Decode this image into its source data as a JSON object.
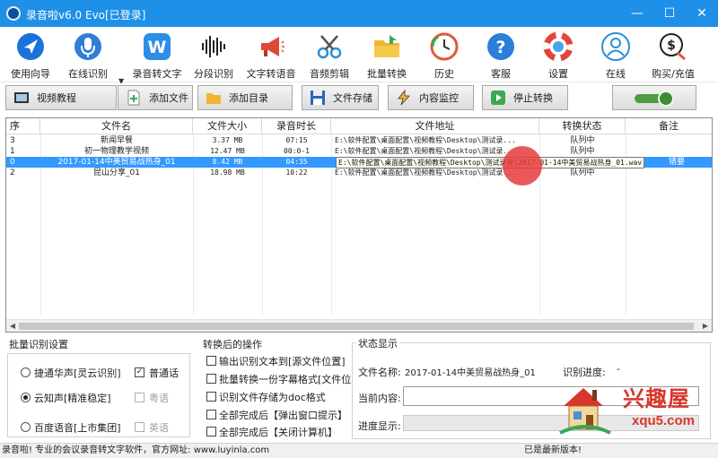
{
  "window": {
    "title": "录音啦v6.0 Evo[已登录]",
    "controls": [
      "—",
      "☐",
      "✕"
    ]
  },
  "toolbar": {
    "items": [
      {
        "label": "使用向导",
        "icon": "navigation-arrow-icon"
      },
      {
        "label": "在线识别",
        "icon": "microphone-icon"
      },
      {
        "label": "录音转文字",
        "icon": "w-letter-icon"
      },
      {
        "label": "分段识别",
        "icon": "soundwave-icon"
      },
      {
        "label": "文字转语音",
        "icon": "megaphone-icon"
      },
      {
        "label": "音频剪辑",
        "icon": "scissors-icon"
      },
      {
        "label": "批量转换",
        "icon": "folder-icon"
      },
      {
        "label": "历史",
        "icon": "history-clock-icon"
      },
      {
        "label": "客服",
        "icon": "help-question-icon"
      },
      {
        "label": "设置",
        "icon": "lifebuoy-icon"
      },
      {
        "label": "在线",
        "icon": "user-icon"
      },
      {
        "label": "购买/充值",
        "icon": "dollar-icon"
      }
    ],
    "dropdown": "▼"
  },
  "actions": {
    "video_tutorial": "视频教程",
    "add_file": "添加文件",
    "add_folder": "添加目录",
    "save_file": "文件存储",
    "content_monitor": "内容监控",
    "stop_convert": "停止转换"
  },
  "table": {
    "headers": [
      "序",
      "文件名",
      "文件大小",
      "录音时长",
      "文件地址",
      "转换状态",
      "备注"
    ],
    "rows": [
      {
        "idx": "3",
        "name": "新闻早餐",
        "size": "3.37 MB",
        "dur": "07:15",
        "path": "E:\\软件配置\\桌面配置\\视频教程\\Desktop\\测试录...",
        "status": "队列中",
        "note": "",
        "selected": false
      },
      {
        "idx": "1",
        "name": "初一物理教学视频",
        "size": "12.47 MB",
        "dur": "00:0-1",
        "path": "E:\\软件配置\\桌面配置\\视频教程\\Desktop\\测试录...",
        "status": "队列中",
        "note": "",
        "selected": false
      },
      {
        "idx": "0",
        "name": "2017-01-14中美贸易战热身_01",
        "size": "8.42 MB",
        "dur": "04:35",
        "path": "",
        "status": "",
        "note": "错要",
        "selected": true
      },
      {
        "idx": "2",
        "name": "昆山分享_01",
        "size": "18.98 MB",
        "dur": "10:22",
        "path": "E:\\软件配置\\桌面配置\\视频教程\\Desktop\\测试录...",
        "status": "队列中",
        "note": "",
        "selected": false
      }
    ],
    "tooltip": "E:\\软件配置\\桌面配置\\视频教程\\Desktop\\测试录音\\2017-01-14中美贸易战热身_01.wav"
  },
  "batch_settings": {
    "title": "批量识别设置",
    "options": [
      {
        "label": "捷通华声[灵云识别]",
        "selected": false
      },
      {
        "label": "云知声[精准稳定]",
        "selected": true
      },
      {
        "label": "百度语音[上市集团]",
        "selected": false
      }
    ],
    "languages": [
      {
        "label": "普通话",
        "checked": true,
        "enabled": true
      },
      {
        "label": "粤语",
        "checked": false,
        "enabled": false
      },
      {
        "label": "英语",
        "checked": false,
        "enabled": false
      }
    ]
  },
  "post_actions": {
    "title": "转换后的操作",
    "items": [
      "输出识别文本到[源文件位置]",
      "批量转换一份字幕格式[文件位置]",
      "识别文件存储为doc格式",
      "全部完成后【弹出窗口提示】",
      "全部完成后【关闭计算机】"
    ]
  },
  "status_panel": {
    "title": "状态显示",
    "file_name_label": "文件名称:",
    "file_name_value": "2017-01-14中美贸易战热身_01",
    "progress_label": "识别进度:",
    "progress_value": "-",
    "content_label": "当前内容:",
    "progress_display_label": "进度显示:"
  },
  "statusbar": {
    "left": "录音啦! 专业的会议录音转文字软件，官方网址: www.luyinla.com",
    "right": "已是最新版本!"
  },
  "watermark": {
    "cn": "兴趣屋",
    "url": "xqu5.com"
  },
  "colors": {
    "titlebar": "#1e90e8",
    "selected_row": "#3399ff",
    "toggle": "#4f9a44"
  }
}
